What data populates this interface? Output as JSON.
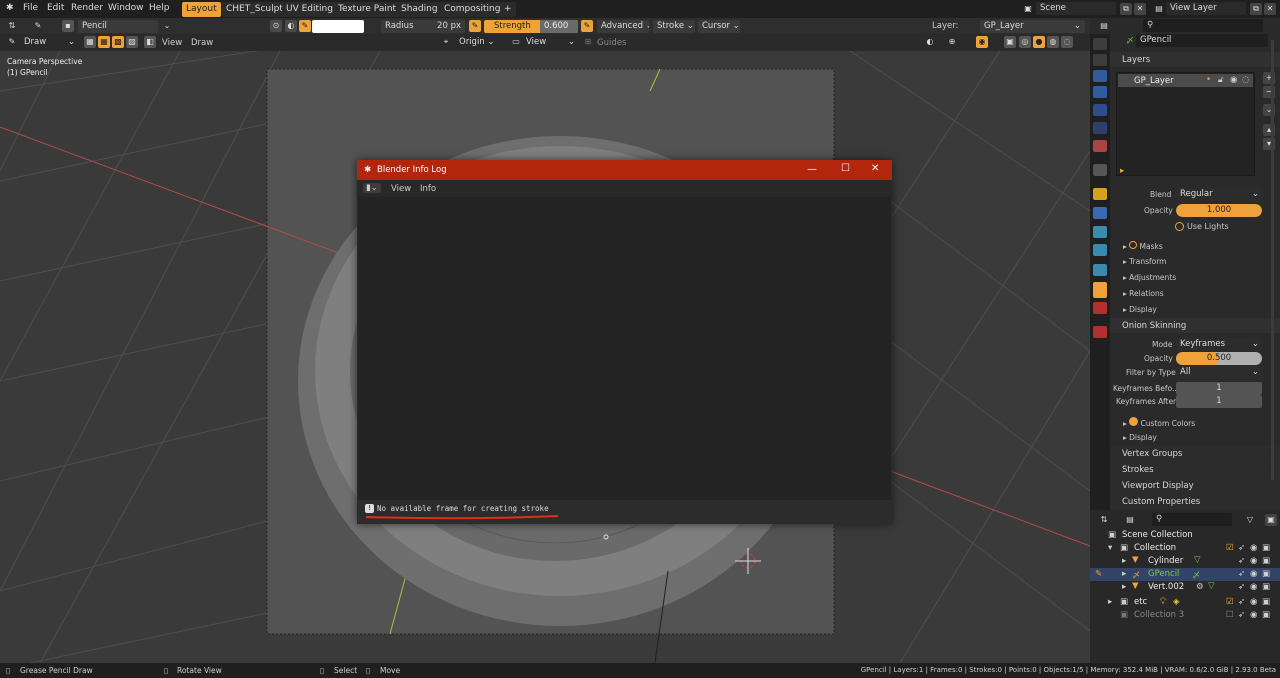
{
  "menu": {
    "file": "File",
    "edit": "Edit",
    "render": "Render",
    "window": "Window",
    "help": "Help"
  },
  "workspaces": [
    "Layout",
    "CHET_Sculpt",
    "UV Editing",
    "Texture Paint",
    "Shading",
    "Compositing",
    "+"
  ],
  "scene": {
    "scene": "Scene",
    "view_layer": "View Layer"
  },
  "toolheader": {
    "brush": "Pencil",
    "radius_label": "Radius",
    "radius_value": "20 px",
    "strength_label": "Strength",
    "strength_value": "0.600",
    "advanced": "Advanced",
    "stroke": "Stroke",
    "cursor": "Cursor",
    "layer_label": "Layer:",
    "layer_value": "GP_Layer"
  },
  "viewheader": {
    "mode": "Draw",
    "view": "View",
    "draw": "Draw",
    "origin": "Origin",
    "view2": "View",
    "guides": "Guides"
  },
  "viewport": {
    "line1": "Camera Perspective",
    "line2": "(1) GPencil"
  },
  "dialog": {
    "title": "Blender Info Log",
    "view": "View",
    "info": "Info",
    "message": "No available frame for creating stroke",
    "min": "—",
    "max": "☐",
    "close": "✕"
  },
  "props": {
    "object": "GPencil",
    "layers_header": "Layers",
    "layer_item": "GP_Layer",
    "blend_label": "Blend",
    "blend_value": "Regular",
    "opacity_label": "Opacity",
    "opacity_value": "1.000",
    "opacity_fraction": 1.0,
    "use_lights": "Use Lights",
    "masks": "Masks",
    "transform": "Transform",
    "adjustments": "Adjustments",
    "relations": "Relations",
    "display": "Display",
    "onion_header": "Onion Skinning",
    "mode_label": "Mode",
    "mode_value": "Keyframes",
    "onion_opacity_label": "Opacity",
    "onion_opacity_value": "0.500",
    "onion_opacity_fraction": 0.5,
    "filter_label": "Filter by Type",
    "filter_value": "All",
    "kf_before_label": "Keyframes Befo...",
    "kf_before_value": "1",
    "kf_after_label": "Keyframes After",
    "kf_after_value": "1",
    "custom_colors": "Custom Colors",
    "display2": "Display",
    "vertex_groups": "Vertex Groups",
    "strokes": "Strokes",
    "viewport_display": "Viewport Display",
    "custom_properties": "Custom Properties"
  },
  "outliner": {
    "scene_collection": "Scene Collection",
    "collection": "Collection",
    "cylinder": "Cylinder",
    "gpencil": "GPencil",
    "vert": "Vert.002",
    "etc": "etc",
    "collection3": "Collection 3"
  },
  "status": {
    "draw": "Grease Pencil Draw",
    "rotate": "Rotate View",
    "select": "Select",
    "move": "Move",
    "info": "GPencil | Layers:1 | Frames:0 | Strokes:0 | Points:0 | Objects:1/5 | Memory: 352.4 MiB | VRAM: 0.6/2.0 GiB | 2.93.0 Beta"
  },
  "colors": {
    "accent": "#f0a23a",
    "dialog_title": "#b3260e",
    "active_row": "#334466",
    "gp_green": "#7ec842"
  }
}
